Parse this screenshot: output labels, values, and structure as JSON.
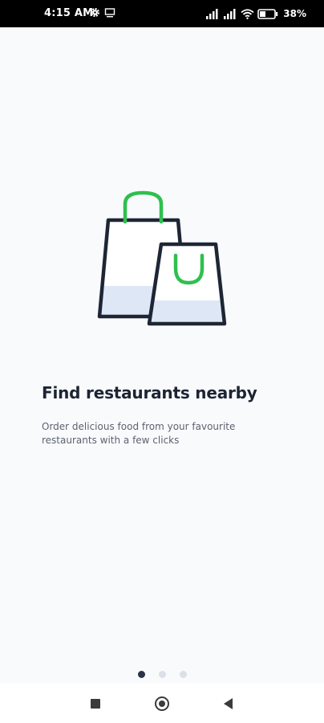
{
  "status_bar": {
    "time": "4:15 AM",
    "battery_percent": "38",
    "icons": [
      "gear-icon",
      "monitor-icon",
      "signal-icon",
      "signal-icon",
      "wifi-icon",
      "battery-icon"
    ]
  },
  "onboarding": {
    "illustration": "shopping-bags-icon",
    "title": "Find restaurants nearby",
    "subtitle": "Order delicious food from your favourite restaurants with a few clicks",
    "page_count": 3,
    "current_page": 1
  },
  "nav_bar": {
    "icons": [
      "recent-apps-icon",
      "home-icon",
      "back-icon"
    ]
  },
  "colors": {
    "accent_green": "#2fbf4f",
    "outline": "#1e2635",
    "bag_fill": "#dde7f6",
    "title": "#1d2433",
    "dot_active": "#2b3345",
    "dot_inactive": "#dcdfe5"
  }
}
